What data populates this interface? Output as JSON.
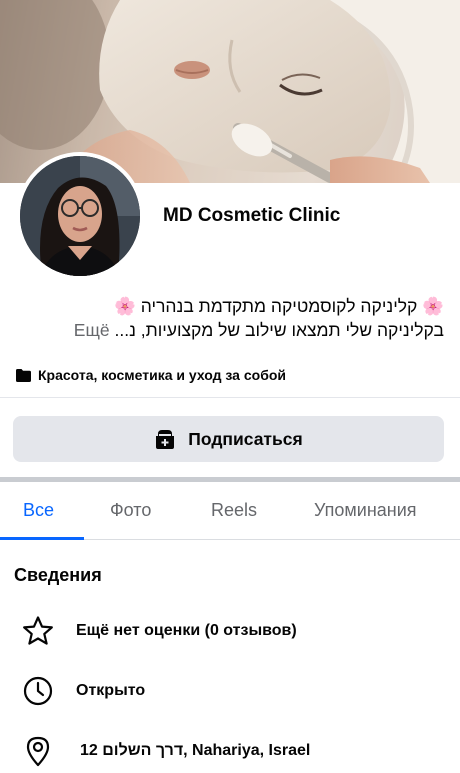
{
  "header": {
    "page_name": "MD Cosmetic Clinic"
  },
  "bio": {
    "line1": "🌸 קליניקה לקוסמטיקה מתקדמת בנהריה 🌸",
    "line2": "בקליניקה שלי תמצאו שילוב של מקצועיות, נ...",
    "more_label": "Ещё"
  },
  "category": {
    "label": "Красота, косметика и уход за собой",
    "icon": "folder-icon"
  },
  "follow_button": {
    "label": "Подписаться",
    "icon": "add-page-icon"
  },
  "tabs": [
    {
      "label": "Все",
      "active": true
    },
    {
      "label": "Фото",
      "active": false
    },
    {
      "label": "Reels",
      "active": false
    },
    {
      "label": "Упоминания",
      "active": false
    }
  ],
  "details": {
    "title": "Сведения",
    "rating": {
      "icon": "star-icon",
      "text": "Ещё нет оценки (0 отзывов)"
    },
    "hours": {
      "icon": "clock-icon",
      "text": "Открыто"
    },
    "address": {
      "icon": "location-pin-icon",
      "text": "דרך השלום 12, Nahariya, Israel"
    }
  },
  "colors": {
    "accent": "#0866ff",
    "button_bg": "#e4e6eb",
    "secondary_text": "#65676b",
    "flower": "#e05a9a"
  }
}
